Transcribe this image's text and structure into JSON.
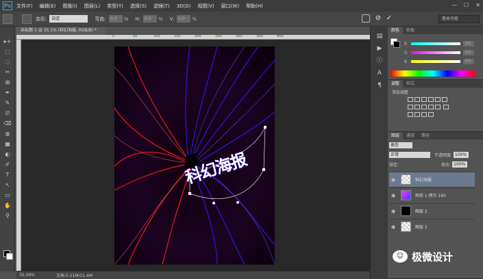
{
  "app": {
    "logo": "Ps"
  },
  "menubar": {
    "items": [
      "文件(F)",
      "编辑(E)",
      "图像(I)",
      "图层(L)",
      "类型(Y)",
      "选择(S)",
      "滤镜(T)",
      "3D(D)",
      "视图(V)",
      "窗口(W)",
      "帮助(H)"
    ],
    "window_controls": [
      "—",
      "☐",
      "✕"
    ]
  },
  "options": {
    "warp_label": "变形:",
    "warp_value": "自定",
    "bend_label": "弯曲:",
    "bend_value": "0.0",
    "h_label": "H:",
    "h_value": "0.0",
    "v_label": "V:",
    "v_value": "0.0",
    "pct": "%",
    "cancel": "⊘",
    "commit": "✓",
    "workspace": "基本功能"
  },
  "document": {
    "tab": "未标题-1 @ 35.1% (科幻海报, RGB/8) *",
    "ruler_marks": [
      "0",
      "50",
      "100",
      "150",
      "200",
      "250",
      "300",
      "350",
      "400"
    ],
    "art_text": "科幻海报"
  },
  "tools": [
    "▸+",
    "⬚",
    "◌",
    "✂",
    "⊞",
    "✒",
    "✎",
    "⎚",
    "⌫",
    "◍",
    "▦",
    "◐",
    "✐",
    "T",
    "↖",
    "▭",
    "✋",
    "⚲"
  ],
  "statusbar": {
    "zoom": "35.09%",
    "doc_info": "文档:5.51M/21.4M"
  },
  "color_panel": {
    "tabs": [
      "颜色",
      "色板"
    ],
    "r_label": "R",
    "r_value": "255",
    "g_label": "G",
    "g_value": "255",
    "b_label": "B",
    "b_value": "255"
  },
  "adjust_panel": {
    "tabs": [
      "调整",
      "样式"
    ],
    "title": "添加调整"
  },
  "layers_panel": {
    "tabs": [
      "图层",
      "通道",
      "路径"
    ],
    "kind": "类型",
    "blend": "正常",
    "opacity_label": "不透明度:",
    "opacity_value": "100%",
    "lock_label": "锁定:",
    "fill_label": "填充:",
    "fill_value": "100%",
    "layers": [
      {
        "name": "科幻海报",
        "selected": true
      },
      {
        "name": "矩形 1 拷贝 160",
        "selected": false
      },
      {
        "name": "图层 2",
        "selected": false
      },
      {
        "name": "图层 1",
        "selected": false
      }
    ]
  },
  "watermark": {
    "logo": "☺",
    "text": "极微设计"
  },
  "colors": {
    "accent_red": "#ff1a1a",
    "accent_blue": "#2a1aff",
    "selected_layer": "#6b7a8c"
  }
}
